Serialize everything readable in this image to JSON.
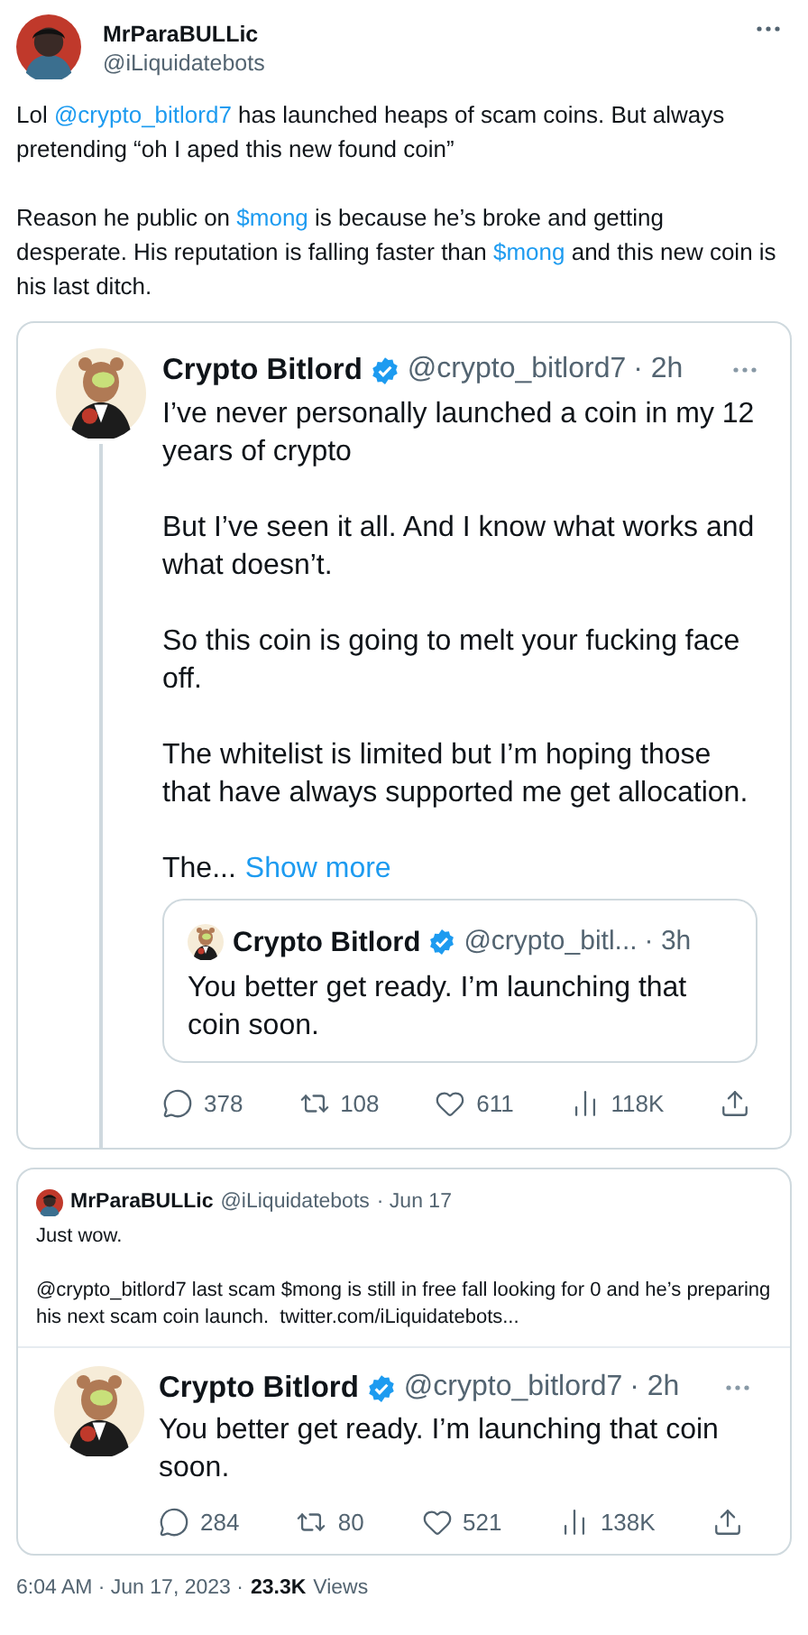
{
  "tweet": {
    "name": "MrParaBULLic",
    "handle": "@iLiquidatebots",
    "paragraphs": [
      [
        {
          "text": "Lol ",
          "link": false
        },
        {
          "text": "@crypto_bitlord7",
          "link": true
        },
        {
          "text": " has launched heaps of scam coins. But always pretending “oh I aped this new found coin”",
          "link": false
        }
      ],
      [
        {
          "text": "Reason he public on ",
          "link": false
        },
        {
          "text": "$mong",
          "link": true
        },
        {
          "text": " is because he’s broke and getting desperate. His reputation is falling faster than ",
          "link": false
        },
        {
          "text": "$mong",
          "link": true
        },
        {
          "text": " and this new coin is his last ditch.",
          "link": false
        }
      ]
    ]
  },
  "quote_1": {
    "name": "Crypto Bitlord",
    "verified": true,
    "handle": "@crypto_bitlord7",
    "time": "· 2h",
    "paragraphs": [
      "I’ve never personally launched a coin in my 12 years of crypto",
      "But I’ve seen it all. And I know what works and what doesn’t.",
      "So this coin is going to melt your fucking face off.",
      "The whitelist is limited but I’m hoping those that have always supported me get allocation."
    ],
    "truncated": "The...",
    "show_more": "Show more",
    "inner_quote": {
      "name": "Crypto Bitlord",
      "verified": true,
      "handle": "@crypto_bitl...",
      "time": "· 3h",
      "text": "You better get ready. I’m launching that coin soon."
    },
    "actions": [
      {
        "kind": "reply",
        "count": "378"
      },
      {
        "kind": "repost",
        "count": "108"
      },
      {
        "kind": "like",
        "count": "611"
      },
      {
        "kind": "views",
        "count": "118K"
      },
      {
        "kind": "share"
      }
    ]
  },
  "quote_2": {
    "name": "MrParaBULLic",
    "handle": "@iLiquidatebots",
    "date": "· Jun 17",
    "paragraphs": [
      "Just wow.",
      "@crypto_bitlord7 last scam $mong is still in free fall looking for 0 and he’s preparing his next scam coin launch.  twitter.com/iLiquidatebots..."
    ],
    "embedded": {
      "name": "Crypto Bitlord",
      "verified": true,
      "handle": "@crypto_bitlord7",
      "time": "· 2h",
      "text": "You better get ready. I’m launching that coin soon.",
      "actions": [
        {
          "kind": "reply",
          "count": "284"
        },
        {
          "kind": "repost",
          "count": "80"
        },
        {
          "kind": "like",
          "count": "521"
        },
        {
          "kind": "views",
          "count": "138K"
        },
        {
          "kind": "share"
        }
      ]
    }
  },
  "footer": {
    "timestamp": "6:04 AM · Jun 17, 2023 ·",
    "views_count": "23.3K",
    "views_label": "Views"
  }
}
